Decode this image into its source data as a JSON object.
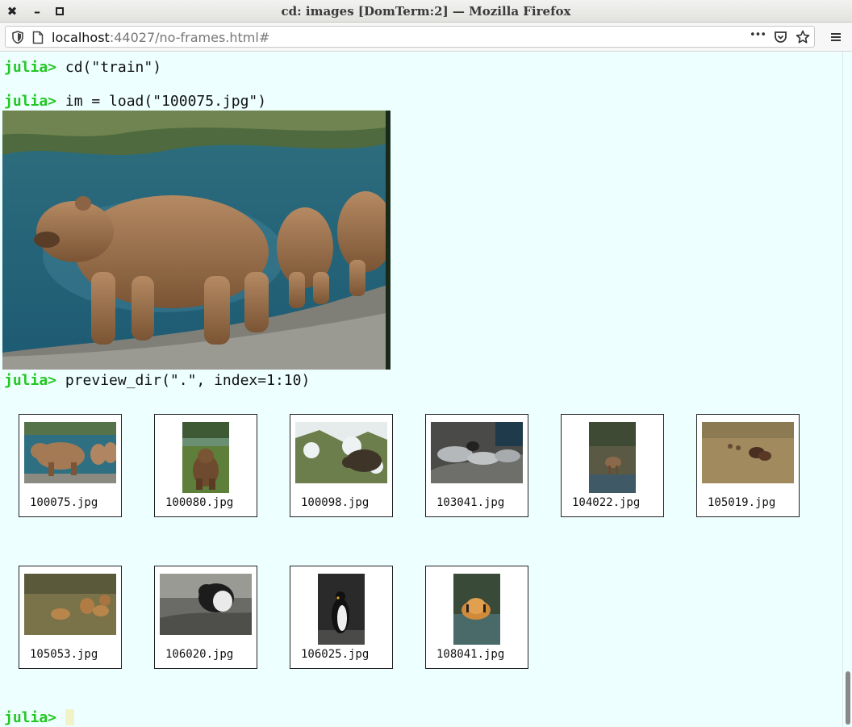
{
  "window": {
    "title": "cd: images [DomTerm:2] — Mozilla Firefox",
    "close_glyph": "✖",
    "minimize_glyph": "–",
    "maximize_glyph": "▫"
  },
  "browser": {
    "url_host": "localhost",
    "url_rest": ":44027/no-frames.html#",
    "more_glyph": "•••"
  },
  "terminal": {
    "prompt": "julia> ",
    "commands": [
      "cd(\"train\")",
      "im = load(\"100075.jpg\")",
      "preview_dir(\".\", index=1:10)"
    ],
    "thumbnails": [
      {
        "file": "100075.jpg",
        "subject": "bear-with-cubs"
      },
      {
        "file": "100080.jpg",
        "subject": "bear-in-grass"
      },
      {
        "file": "100098.jpg",
        "subject": "bear-in-snow"
      },
      {
        "file": "103041.jpg",
        "subject": "seals-on-rocks"
      },
      {
        "file": "104022.jpg",
        "subject": "deer-by-water"
      },
      {
        "file": "105019.jpg",
        "subject": "wild-dogs-field"
      },
      {
        "file": "105053.jpg",
        "subject": "lion-cubs"
      },
      {
        "file": "106020.jpg",
        "subject": "penguin-nesting"
      },
      {
        "file": "106025.jpg",
        "subject": "penguin-standing"
      },
      {
        "file": "108041.jpg",
        "subject": "tiger-in-water"
      }
    ]
  }
}
